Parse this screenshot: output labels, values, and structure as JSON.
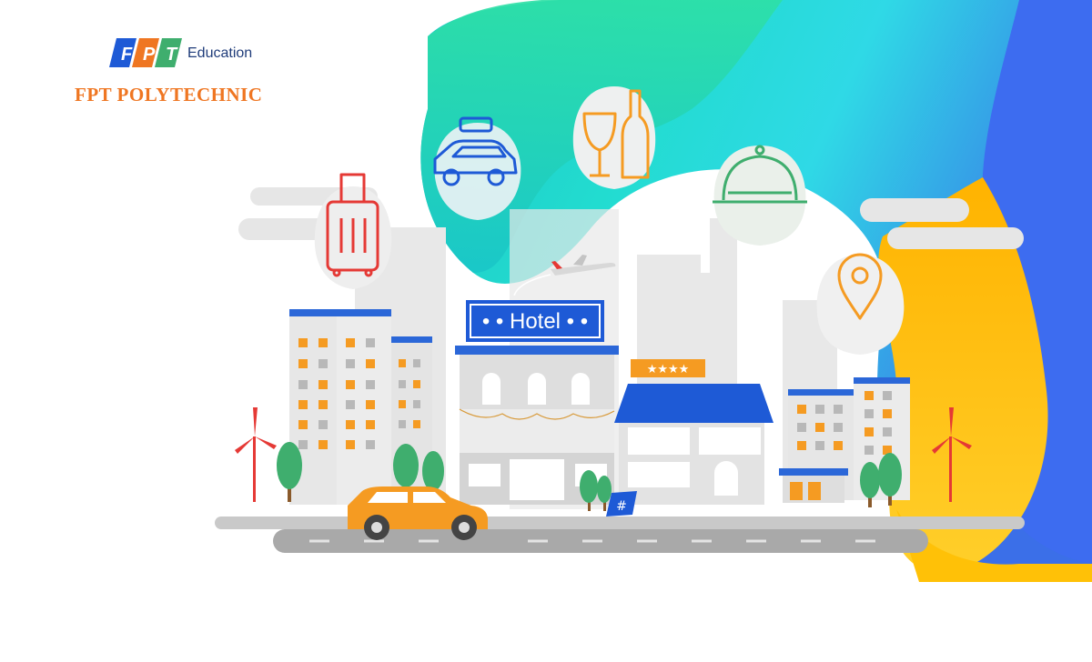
{
  "brand": {
    "logo_text": "FPT",
    "education": "Education",
    "school": "FPT POLYTECHNIC"
  },
  "hotel_sign": "• • Hotel • •",
  "star_sign": "★★★★",
  "hash_sign": "#",
  "icons": [
    "suitcase-icon",
    "car-icon",
    "wine-icon",
    "dish-cloche-icon",
    "location-pin-icon",
    "airplane-icon"
  ],
  "colors": {
    "brand_orange": "#ef7622",
    "brand_blue": "#1f3c7a",
    "teal": "#1fd3c4",
    "blue": "#3b6fe8",
    "yellow": "#ffc107",
    "hotel_blue": "#1e5ad6"
  }
}
